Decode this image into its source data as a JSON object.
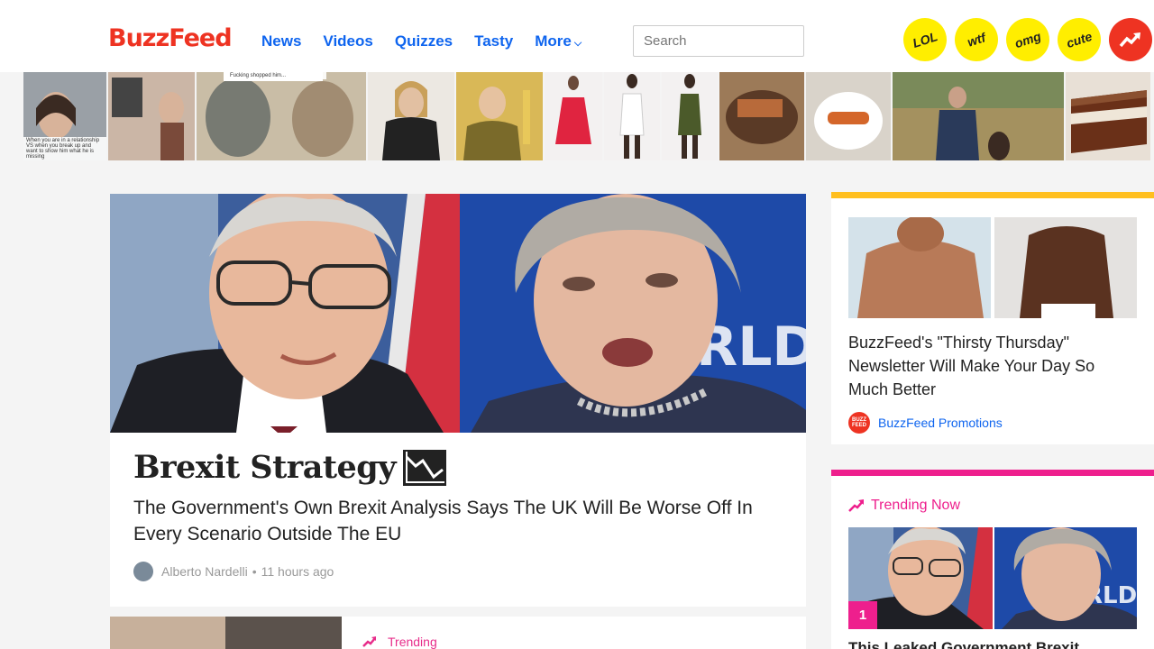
{
  "header": {
    "logo": "BuzzFeed",
    "nav": [
      {
        "label": "News"
      },
      {
        "label": "Videos"
      },
      {
        "label": "Quizzes"
      },
      {
        "label": "Tasty"
      },
      {
        "label": "More"
      }
    ],
    "search_placeholder": "Search",
    "badges": [
      "LOL",
      "wtf",
      "omg",
      "cute"
    ]
  },
  "strip": {
    "caption_1": "When you are in a relationship VS when you break up and want to show him what he is missing",
    "caption_2": "Fucking shopped him..."
  },
  "main": {
    "kicker": "Brexit Strategy",
    "headline": "The Government's Own Brexit Analysis Says The UK Will Be Worse Off In Every Scenario Outside The EU",
    "author": "Alberto Nardelli",
    "time": "11 hours ago"
  },
  "second": {
    "trending_label": "Trending"
  },
  "promo": {
    "title": "BuzzFeed's \"Thirsty Thursday\" Newsletter Will Make Your Day So Much Better",
    "source": "BuzzFeed Promotions",
    "source_logo": "BUZZ FEED"
  },
  "trending": {
    "heading": "Trending Now",
    "rank": "1",
    "title": "This Leaked Government Brexit"
  },
  "colors": {
    "brand_red": "#ee3322",
    "link_blue": "#0f65ef",
    "badge_yellow": "#ffee00",
    "promo_accent": "#ffbf1f",
    "trending_pink": "#ee1f8d"
  }
}
